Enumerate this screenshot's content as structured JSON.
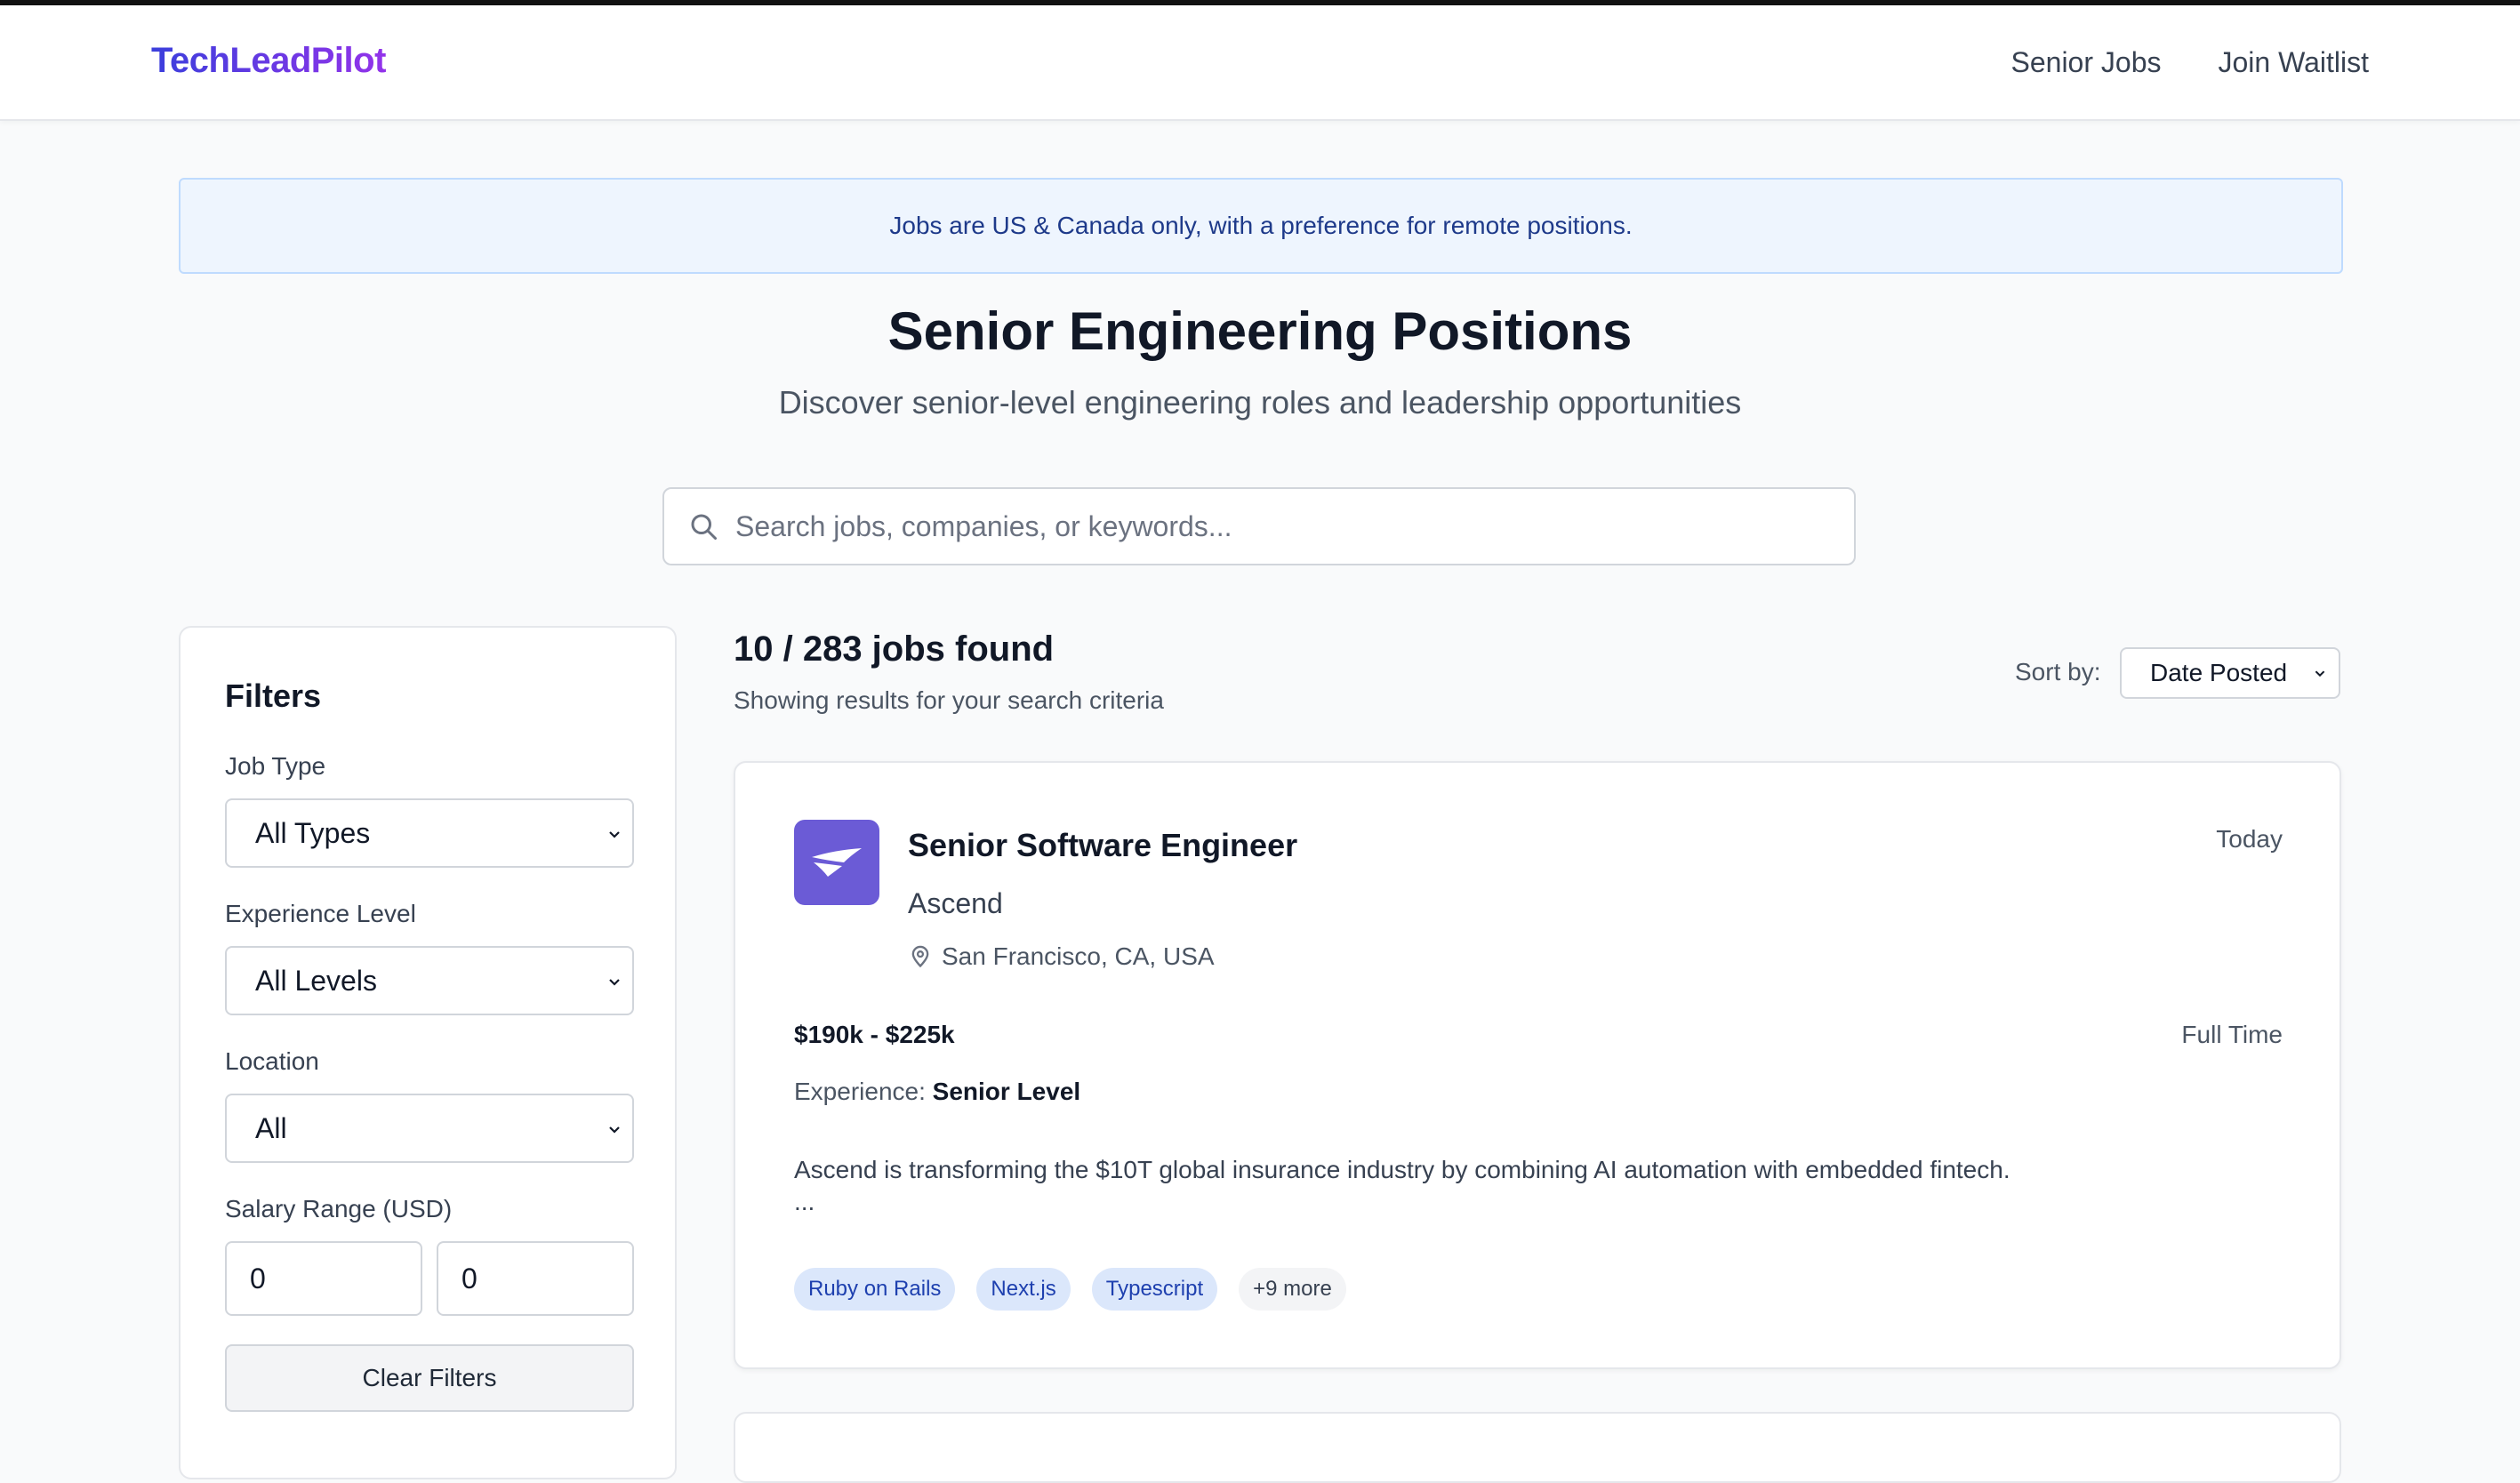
{
  "nav": {
    "logo": "TechLeadPilot",
    "links": [
      "Senior Jobs",
      "Join Waitlist"
    ]
  },
  "banner": "Jobs are US & Canada only, with a preference for remote positions.",
  "hero": {
    "title": "Senior Engineering Positions",
    "subtitle": "Discover senior-level engineering roles and leadership opportunities"
  },
  "search": {
    "placeholder": "Search jobs, companies, or keywords...",
    "value": ""
  },
  "filters": {
    "title": "Filters",
    "job_type_label": "Job Type",
    "job_type_value": "All Types",
    "experience_label": "Experience Level",
    "experience_value": "All Levels",
    "location_label": "Location",
    "location_value": "All",
    "salary_label": "Salary Range (USD)",
    "salary_min": "0",
    "salary_max": "0",
    "clear_label": "Clear Filters"
  },
  "results": {
    "count": "10 / 283 jobs found",
    "subtitle": "Showing results for your search criteria",
    "sort_label": "Sort by:",
    "sort_value": "Date Posted"
  },
  "jobs": [
    {
      "title": "Senior Software Engineer",
      "company": "Ascend",
      "location": "San Francisco, CA, USA",
      "posted": "Today",
      "salary": "$190k - $225k",
      "type": "Full Time",
      "experience_label": "Experience:",
      "experience_value": "Senior Level",
      "description": "Ascend is transforming the $10T global insurance industry by combining AI automation with embedded fintech.",
      "ellipsis": "...",
      "tags": [
        "Ruby on Rails",
        "Next.js",
        "Typescript"
      ],
      "more_tags": "+9 more",
      "logo_color": "#6b5bd6"
    }
  ],
  "colors": {
    "accent_start": "#3b3fdc",
    "accent_end": "#9333ea",
    "banner_bg": "#eef5fe",
    "tag_bg": "#dbe7fb"
  },
  "icons": [
    "search-icon",
    "chevron-down-icon",
    "location-pin-icon",
    "company-logo-icon"
  ]
}
